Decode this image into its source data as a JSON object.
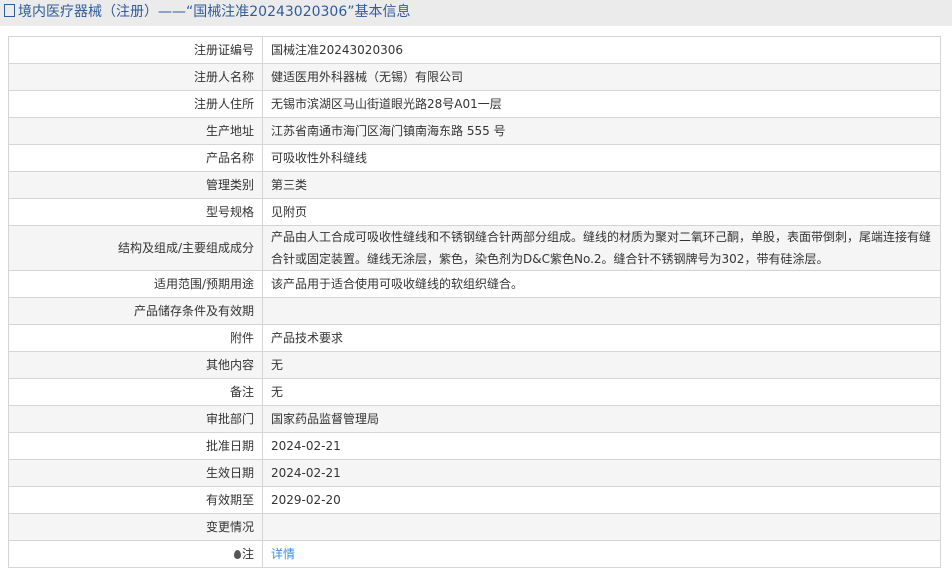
{
  "header": {
    "title": "境内医疗器械（注册）——“国械注准20243020306”基本信息"
  },
  "rows": [
    {
      "label": "注册证编号",
      "value": "国械注准20243020306"
    },
    {
      "label": "注册人名称",
      "value": "健适医用外科器械（无锡）有限公司"
    },
    {
      "label": "注册人住所",
      "value": "无锡市滨湖区马山街道眼光路28号A01一层"
    },
    {
      "label": "生产地址",
      "value": "江苏省南通市海门区海门镇南海东路 555 号"
    },
    {
      "label": "产品名称",
      "value": "可吸收性外科缝线"
    },
    {
      "label": "管理类别",
      "value": "第三类"
    },
    {
      "label": "型号规格",
      "value": "见附页"
    },
    {
      "label": "结构及组成/主要组成成分",
      "value": "产品由人工合成可吸收性缝线和不锈钢缝合针两部分组成。缝线的材质为聚对二氧环己酮，单股，表面带倒刺，尾端连接有缝合针或固定装置。缝线无涂层，紫色，染色剂为D&C紫色No.2。缝合针不锈钢牌号为302，带有硅涂层。"
    },
    {
      "label": "适用范围/预期用途",
      "value": "该产品用于适合使用可吸收缝线的软组织缝合。"
    },
    {
      "label": "产品储存条件及有效期",
      "value": ""
    },
    {
      "label": "附件",
      "value": "产品技术要求"
    },
    {
      "label": "其他内容",
      "value": "无"
    },
    {
      "label": "备注",
      "value": "无"
    },
    {
      "label": "审批部门",
      "value": "国家药品监督管理局"
    },
    {
      "label": "批准日期",
      "value": "2024-02-21"
    },
    {
      "label": "生效日期",
      "value": "2024-02-21"
    },
    {
      "label": "有效期至",
      "value": "2029-02-20"
    },
    {
      "label": "变更情况",
      "value": ""
    },
    {
      "label": "注",
      "value": "详情"
    }
  ]
}
